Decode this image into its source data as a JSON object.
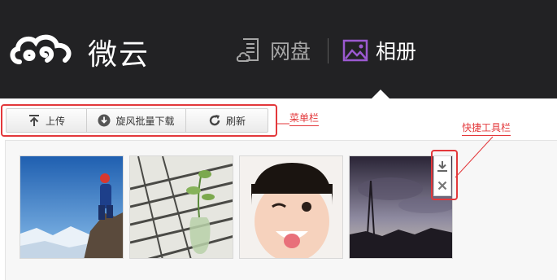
{
  "header": {
    "logo_text": "微云",
    "nav": [
      {
        "label": "网盘",
        "icon": "cloud-document-icon",
        "active": false
      },
      {
        "label": "相册",
        "icon": "picture-icon",
        "active": true
      }
    ]
  },
  "toolbar": {
    "buttons": [
      {
        "label": "上传",
        "icon": "upload-icon"
      },
      {
        "label": "旋风批量下载",
        "icon": "download-circle-icon"
      },
      {
        "label": "刷新",
        "icon": "refresh-icon"
      }
    ]
  },
  "annotations": {
    "menu_bar": "菜单栏",
    "quick_toolbar": "快捷工具栏"
  },
  "photos": [
    {
      "subject": "mountaineer-on-snowy-peak"
    },
    {
      "subject": "plant-in-glass-vase"
    },
    {
      "subject": "child-winking"
    },
    {
      "subject": "dusk-sky-silhouette"
    }
  ],
  "quick_tools": [
    {
      "icon": "download-icon"
    },
    {
      "icon": "close-icon"
    }
  ],
  "colors": {
    "header_bg": "#222224",
    "annotation_red": "#e3383b",
    "album_icon_purple": "#9b59d0"
  }
}
